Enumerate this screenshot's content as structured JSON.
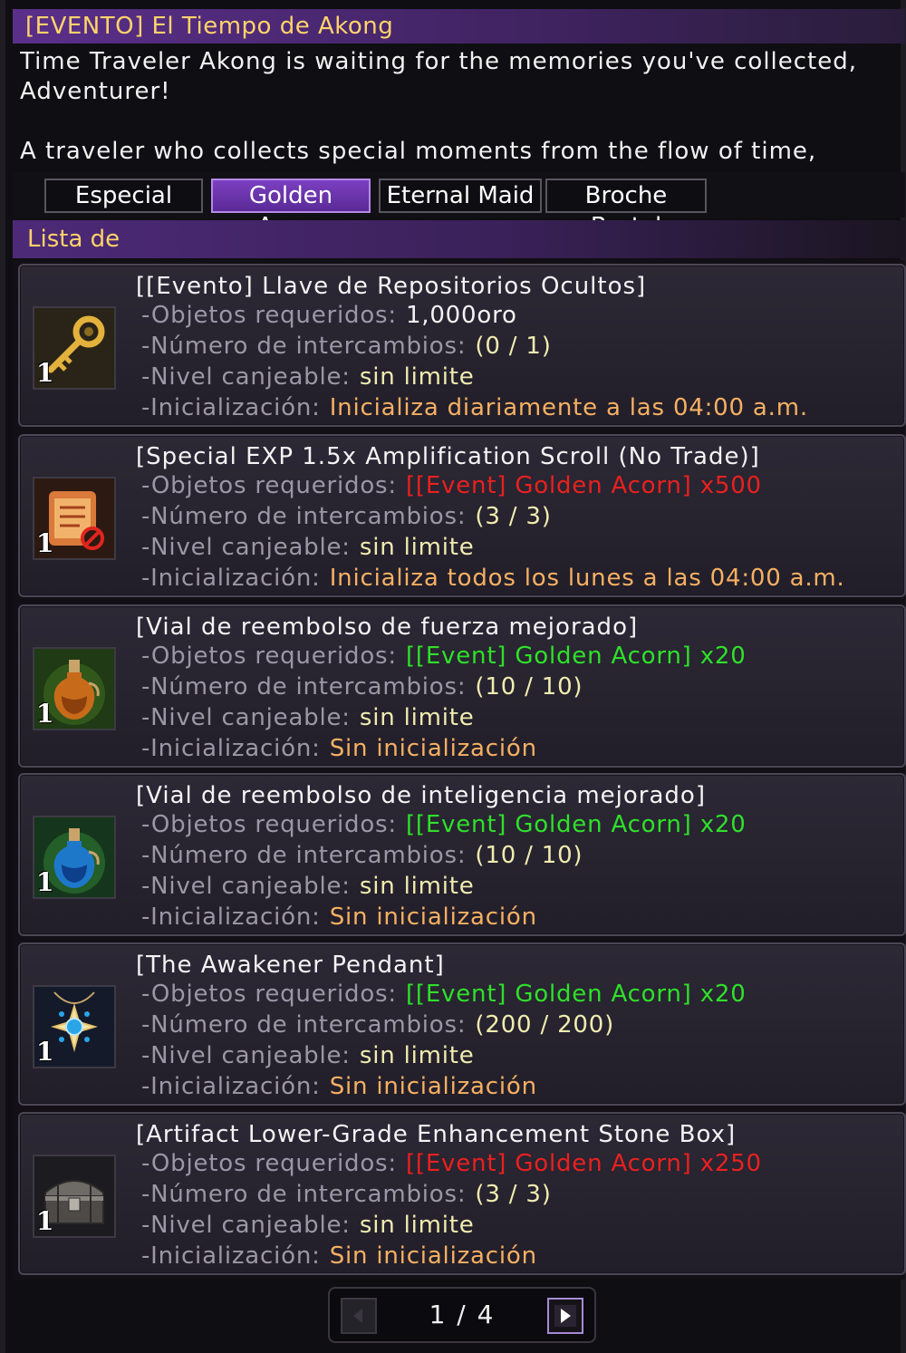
{
  "window": {
    "title": "[EVENTO] El Tiempo de Akong",
    "description": [
      "Time Traveler Akong is waiting for the memories you've collected,",
      "Adventurer!",
      "",
      "A traveler who collects special moments from the flow of time,"
    ]
  },
  "tabs": [
    {
      "label": "Especial",
      "active": false
    },
    {
      "label": "Golden Acorn",
      "active": true
    },
    {
      "label": "Eternal Maid",
      "active": false
    },
    {
      "label": "Broche Brutal",
      "active": false
    }
  ],
  "list_header": "Lista de",
  "labels": {
    "required": "-Objetos requeridos:",
    "exchanges": "-Número de intercambios:",
    "level": "-Nivel canjeable:",
    "reset": "-Inicialización:"
  },
  "items": [
    {
      "name": "[[Evento] Llave de Repositorios Ocultos]",
      "icon": "golden-key-icon",
      "quantity": "1",
      "required": "1,000oro",
      "required_color": "white",
      "exchanges": "(0 / 1)",
      "level": "sin limite",
      "reset": "Inicializa diariamente a las 04:00 a.m."
    },
    {
      "name": "[Special EXP 1.5x Amplification Scroll (No Trade)]",
      "icon": "scroll-icon",
      "quantity": "1",
      "required": "[[Event] Golden Acorn] x500",
      "required_color": "red",
      "exchanges": "(3 / 3)",
      "level": "sin limite",
      "reset": "Inicializa todos los lunes a las 04:00 a.m."
    },
    {
      "name": "[Vial de reembolso de fuerza mejorado]",
      "icon": "orange-potion-icon",
      "quantity": "1",
      "required": "[[Event] Golden Acorn] x20",
      "required_color": "green",
      "exchanges": "(10 / 10)",
      "level": "sin limite",
      "reset": "Sin inicialización"
    },
    {
      "name": "[Vial de reembolso de inteligencia mejorado]",
      "icon": "blue-potion-icon",
      "quantity": "1",
      "required": "[[Event] Golden Acorn] x20",
      "required_color": "green",
      "exchanges": "(10 / 10)",
      "level": "sin limite",
      "reset": "Sin inicialización"
    },
    {
      "name": "[The Awakener Pendant]",
      "icon": "pendant-icon",
      "quantity": "1",
      "required": "[[Event] Golden Acorn] x20",
      "required_color": "green",
      "exchanges": "(200 / 200)",
      "level": "sin limite",
      "reset": "Sin inicialización"
    },
    {
      "name": "[Artifact Lower-Grade Enhancement Stone Box]",
      "icon": "treasure-chest-icon",
      "quantity": "1",
      "required": "[[Event] Golden Acorn] x250",
      "required_color": "red",
      "exchanges": "(3 / 3)",
      "level": "sin limite",
      "reset": "Sin inicialización"
    }
  ],
  "pager": {
    "text": "1 / 4",
    "prev_icon": "arrow-left-icon",
    "next_icon": "arrow-right-icon"
  },
  "colors": {
    "accent_purple": "#5a2a96",
    "title_gold": "#ffd36b",
    "red": "#e8211f",
    "green": "#2fe02a",
    "orange": "#f6b063"
  }
}
